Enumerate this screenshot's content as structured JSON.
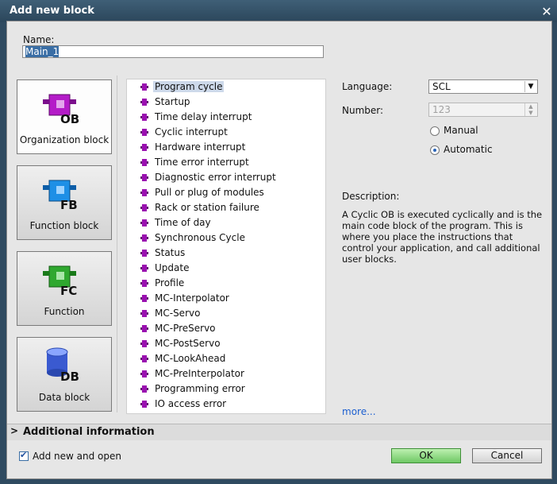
{
  "window": {
    "title": "Add new block"
  },
  "name": {
    "label": "Name:",
    "value": "Main_1"
  },
  "blocks": [
    {
      "label": "Organization block",
      "code": "OB",
      "color": "#b000c8"
    },
    {
      "label": "Function block",
      "code": "FB",
      "color": "#1e8fe6"
    },
    {
      "label": "Function",
      "code": "FC",
      "color": "#2fa82f"
    },
    {
      "label": "Data block",
      "code": "DB",
      "color": "#3a5ad0"
    }
  ],
  "ob_types": [
    "Program cycle",
    "Startup",
    "Time delay interrupt",
    "Cyclic interrupt",
    "Hardware interrupt",
    "Time error interrupt",
    "Diagnostic error interrupt",
    "Pull or plug of modules",
    "Rack or station failure",
    "Time of day",
    "Synchronous Cycle",
    "Status",
    "Update",
    "Profile",
    "MC-Interpolator",
    "MC-Servo",
    "MC-PreServo",
    "MC-PostServo",
    "MC-LookAhead",
    "MC-PreInterpolator",
    "Programming error",
    "IO access error"
  ],
  "form": {
    "language_label": "Language:",
    "language_value": "SCL",
    "number_label": "Number:",
    "number_value": "123",
    "manual_label": "Manual",
    "automatic_label": "Automatic"
  },
  "description": {
    "label": "Description:",
    "text": "A Cyclic OB is executed cyclically and is the main code block of the program. This is where you place the instructions that control your application, and call additional user blocks.",
    "more": "more..."
  },
  "additional_info": "Additional information",
  "footer": {
    "add_open_label": "Add new and open",
    "ok": "OK",
    "cancel": "Cancel"
  },
  "colors": {
    "ob_icon": "#9a10b0",
    "ok_button": "#7fd472"
  }
}
